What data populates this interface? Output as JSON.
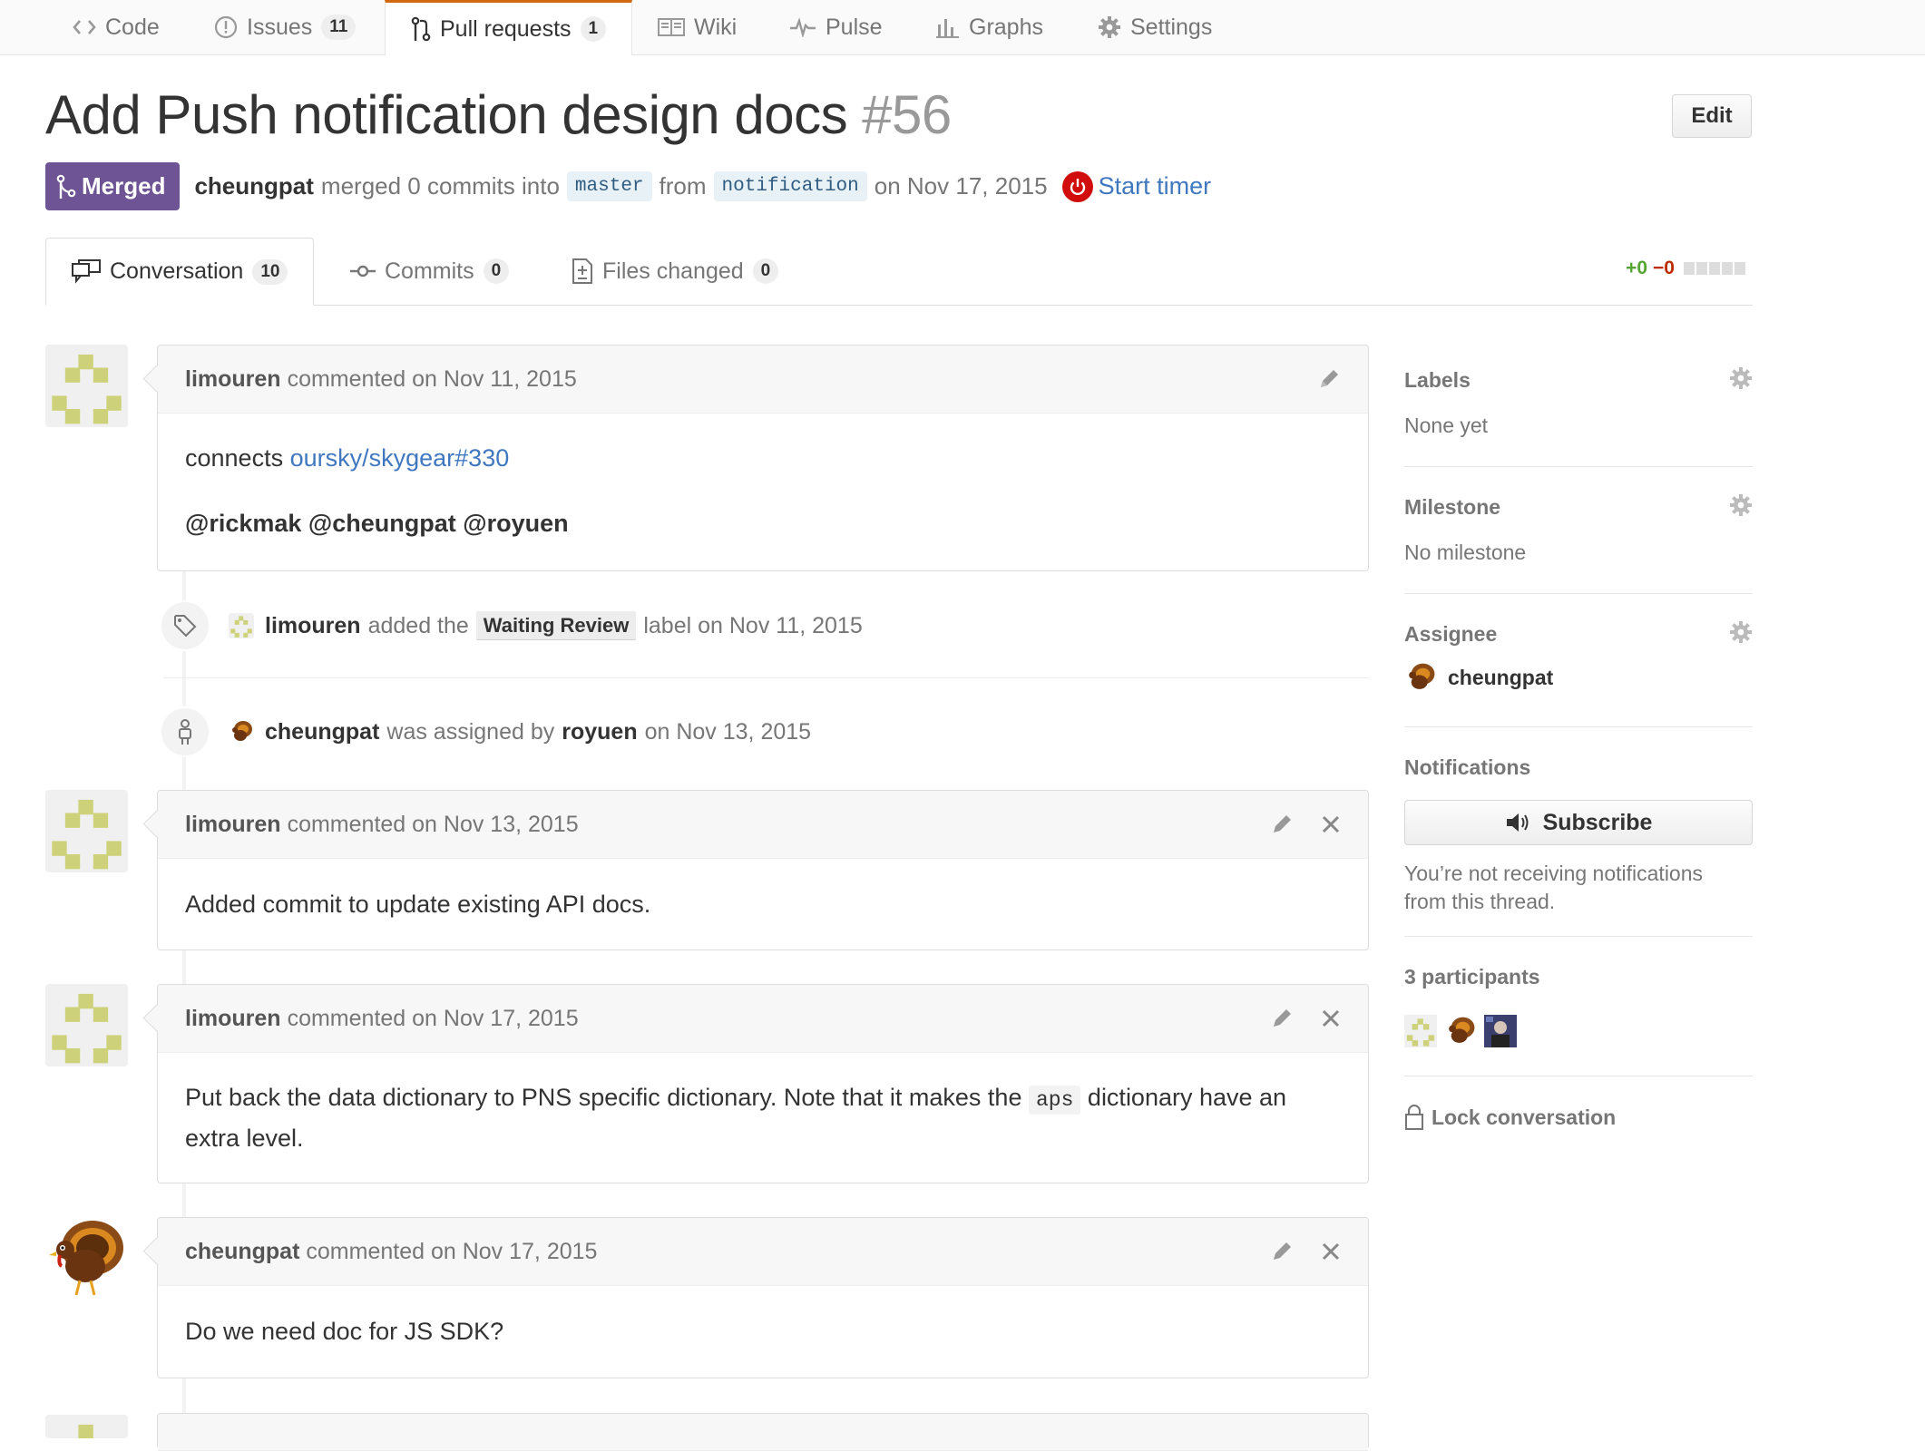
{
  "repo_nav": {
    "tabs": [
      {
        "label": "Code",
        "icon": "code-icon"
      },
      {
        "label": "Issues",
        "icon": "issue-opened-icon",
        "count": "11"
      },
      {
        "label": "Pull requests",
        "icon": "git-pull-request-icon",
        "count": "1",
        "selected": true
      },
      {
        "label": "Wiki",
        "icon": "book-icon"
      },
      {
        "label": "Pulse",
        "icon": "pulse-icon"
      },
      {
        "label": "Graphs",
        "icon": "graph-icon"
      },
      {
        "label": "Settings",
        "icon": "gear-icon"
      }
    ]
  },
  "pr": {
    "title": "Add Push notification design docs",
    "number": "#56",
    "edit_label": "Edit",
    "state": "Merged",
    "merger": "cheungpat",
    "merge_text": "merged 0 commits into",
    "base_branch": "master",
    "from_text": "from",
    "head_branch": "notification",
    "date_text": "on Nov 17, 2015",
    "timer_label": "Start timer"
  },
  "pr_tabs": {
    "conversation": {
      "label": "Conversation",
      "count": "10"
    },
    "commits": {
      "label": "Commits",
      "count": "0"
    },
    "files": {
      "label": "Files changed",
      "count": "0"
    },
    "diffstat_add": "+0",
    "diffstat_del": "−0"
  },
  "timeline": {
    "comment1": {
      "author": "limouren",
      "meta": "commented on Nov 11, 2015",
      "text_prefix": "connects",
      "link": "oursky/skygear#330",
      "mentions": "@rickmak @cheungpat @royuen"
    },
    "event1": {
      "actor": "limouren",
      "text1": "added the",
      "label": "Waiting Review",
      "text2": "label on Nov 11, 2015"
    },
    "event2": {
      "actor": "cheungpat",
      "text1": "was assigned by",
      "by": "royuen",
      "text2": "on Nov 13, 2015"
    },
    "comment2": {
      "author": "limouren",
      "meta": "commented on Nov 13, 2015",
      "text": "Added commit to update existing API docs."
    },
    "comment3": {
      "author": "limouren",
      "meta": "commented on Nov 17, 2015",
      "text1": "Put back the data dictionary to PNS specific dictionary. Note that it makes the",
      "code": "aps",
      "text2": "dictionary have an",
      "text3": "extra level."
    },
    "comment4": {
      "author": "cheungpat",
      "meta": "commented on Nov 17, 2015",
      "text": "Do we need doc for JS SDK?"
    }
  },
  "sidebar": {
    "labels": {
      "heading": "Labels",
      "value": "None yet"
    },
    "milestone": {
      "heading": "Milestone",
      "value": "No milestone"
    },
    "assignee": {
      "heading": "Assignee",
      "value": "cheungpat"
    },
    "notifications": {
      "heading": "Notifications",
      "button": "Subscribe",
      "note_line1": "You’re not receiving notifications",
      "note_line2": "from this thread."
    },
    "participants": {
      "heading": "3 participants"
    },
    "lock": "Lock conversation"
  },
  "colors": {
    "merged": "#6e5494",
    "link": "#4078c0",
    "timer": "#d10c0c",
    "diff_add": "#55a532",
    "diff_del": "#bd2c00"
  }
}
